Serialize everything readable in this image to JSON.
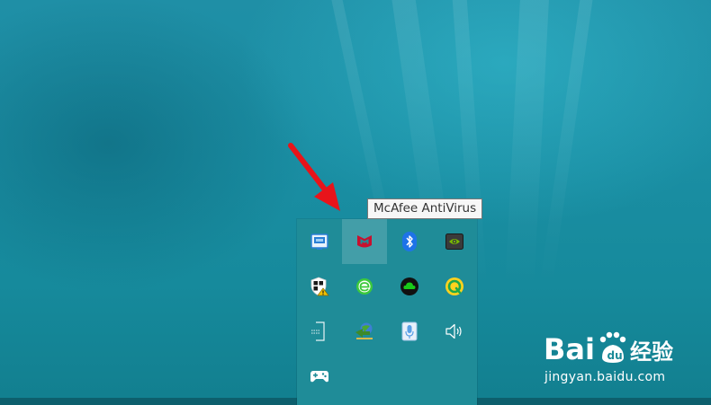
{
  "tooltip": {
    "text": "McAfee AntiVirus"
  },
  "tray": {
    "hovered_icon": "mcafee-icon",
    "icons": [
      {
        "name": "intel-graphics-icon",
        "color": "#2a7fd6"
      },
      {
        "name": "mcafee-icon",
        "color": "#c8102e"
      },
      {
        "name": "bluetooth-icon",
        "color": "#1e73e8"
      },
      {
        "name": "nvidia-icon",
        "color": "#76b900"
      },
      {
        "name": "windows-security-warning-icon",
        "color": "#f2c200"
      },
      {
        "name": "browser-e-icon",
        "color": "#3cc93c"
      },
      {
        "name": "cloud-sync-icon",
        "color": "#19c919"
      },
      {
        "name": "qq-music-icon",
        "color": "#ffd21e"
      },
      {
        "name": "network-device-icon",
        "color": "#ffffff"
      },
      {
        "name": "download-manager-icon",
        "color": "#4aa832"
      },
      {
        "name": "microphone-icon",
        "color": "#5aa0e6"
      },
      {
        "name": "volume-icon",
        "color": "#ffffff"
      },
      {
        "name": "game-controller-icon",
        "color": "#ffffff"
      }
    ]
  },
  "annotation": {
    "arrow_color": "#e8141a"
  },
  "watermark": {
    "logo_text": "Bai du 经验",
    "url": "jingyan.baidu.com"
  }
}
